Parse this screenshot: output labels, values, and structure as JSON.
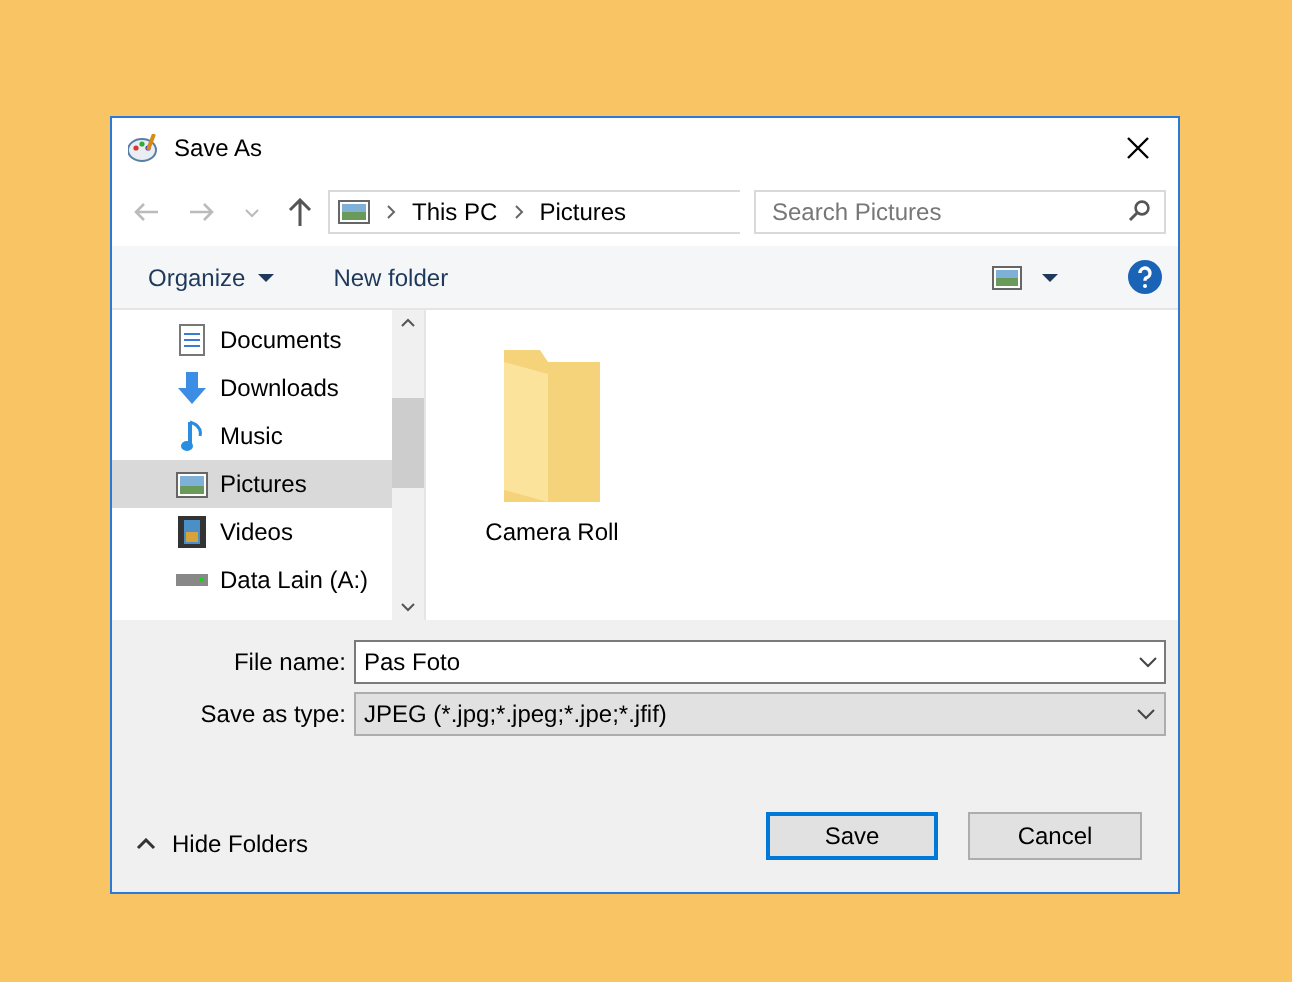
{
  "window": {
    "title": "Save As"
  },
  "address": {
    "crumbs": [
      "This PC",
      "Pictures"
    ],
    "search_placeholder": "Search Pictures"
  },
  "toolbar": {
    "organize": "Organize",
    "new_folder": "New folder"
  },
  "sidebar": {
    "items": [
      {
        "label": "Documents",
        "kind": "documents",
        "selected": false
      },
      {
        "label": "Downloads",
        "kind": "downloads",
        "selected": false
      },
      {
        "label": "Music",
        "kind": "music",
        "selected": false
      },
      {
        "label": "Pictures",
        "kind": "pictures",
        "selected": true
      },
      {
        "label": "Videos",
        "kind": "videos",
        "selected": false
      },
      {
        "label": "Data Lain (A:)",
        "kind": "drive",
        "selected": false
      }
    ]
  },
  "files": [
    {
      "name": "Camera Roll"
    }
  ],
  "form": {
    "file_name_label": "File name:",
    "file_name": "Pas Foto",
    "type_label": "Save as type:",
    "type": "JPEG (*.jpg;*.jpeg;*.jpe;*.jfif)"
  },
  "footer": {
    "hide_folders": "Hide Folders",
    "save": "Save",
    "cancel": "Cancel"
  }
}
